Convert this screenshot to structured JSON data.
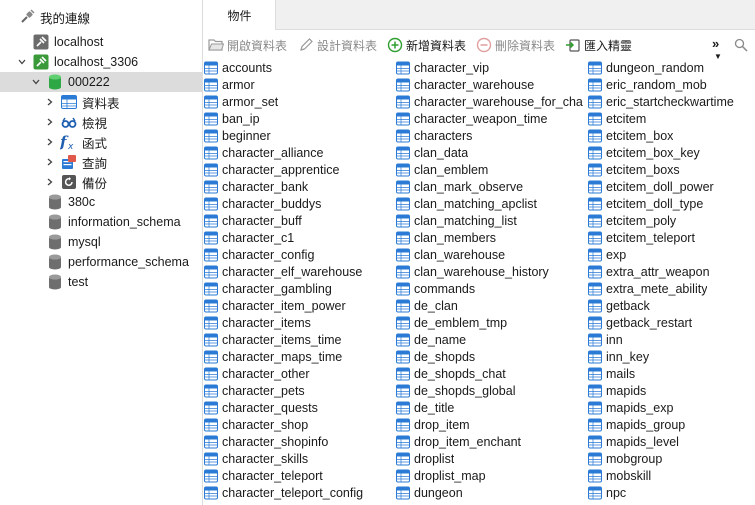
{
  "sidebar": {
    "header": "我的連線",
    "nodes": [
      {
        "label": "localhost"
      },
      {
        "label": "localhost_3306"
      },
      {
        "label": "000222"
      },
      {
        "label": "資料表"
      },
      {
        "label": "檢視"
      },
      {
        "label": "函式"
      },
      {
        "label": "查詢"
      },
      {
        "label": "備份"
      },
      {
        "label": "380c"
      },
      {
        "label": "information_schema"
      },
      {
        "label": "mysql"
      },
      {
        "label": "performance_schema"
      },
      {
        "label": "test"
      }
    ]
  },
  "tabs": {
    "objects": "物件"
  },
  "toolbar": {
    "open_table": "開啟資料表",
    "design_table": "設計資料表",
    "new_table": "新增資料表",
    "delete_table": "刪除資料表",
    "import_wizard": "匯入精靈",
    "more": "»"
  },
  "tables": {
    "col1": [
      "accounts",
      "armor",
      "armor_set",
      "ban_ip",
      "beginner",
      "character_alliance",
      "character_apprentice",
      "character_bank",
      "character_buddys",
      "character_buff",
      "character_c1",
      "character_config",
      "character_elf_warehouse",
      "character_gambling",
      "character_item_power",
      "character_items",
      "character_items_time",
      "character_maps_time",
      "character_other",
      "character_pets",
      "character_quests",
      "character_shop",
      "character_shopinfo",
      "character_skills",
      "character_teleport",
      "character_teleport_config"
    ],
    "col2": [
      "character_vip",
      "character_warehouse",
      "character_warehouse_for_cha",
      "character_weapon_time",
      "characters",
      "clan_data",
      "clan_emblem",
      "clan_mark_observe",
      "clan_matching_apclist",
      "clan_matching_list",
      "clan_members",
      "clan_warehouse",
      "clan_warehouse_history",
      "commands",
      "de_clan",
      "de_emblem_tmp",
      "de_name",
      "de_shopds",
      "de_shopds_chat",
      "de_shopds_global",
      "de_title",
      "drop_item",
      "drop_item_enchant",
      "droplist",
      "droplist_map",
      "dungeon"
    ],
    "col3": [
      "dungeon_random",
      "eric_random_mob",
      "eric_startcheckwartime",
      "etcitem",
      "etcitem_box",
      "etcitem_box_key",
      "etcitem_boxs",
      "etcitem_doll_power",
      "etcitem_doll_type",
      "etcitem_poly",
      "etcitem_teleport",
      "exp",
      "extra_attr_weapon",
      "extra_mete_ability",
      "getback",
      "getback_restart",
      "inn",
      "inn_key",
      "mails",
      "mapids",
      "mapids_exp",
      "mapids_group",
      "mapids_level",
      "mobgroup",
      "mobskill",
      "npc"
    ]
  },
  "colors": {
    "table_icon": "#2b7bd6",
    "connection_green": "#3a9a3a",
    "db_selected": "#34b04a",
    "accent_green": "#2e9e2e",
    "delete_red": "#d06060"
  }
}
